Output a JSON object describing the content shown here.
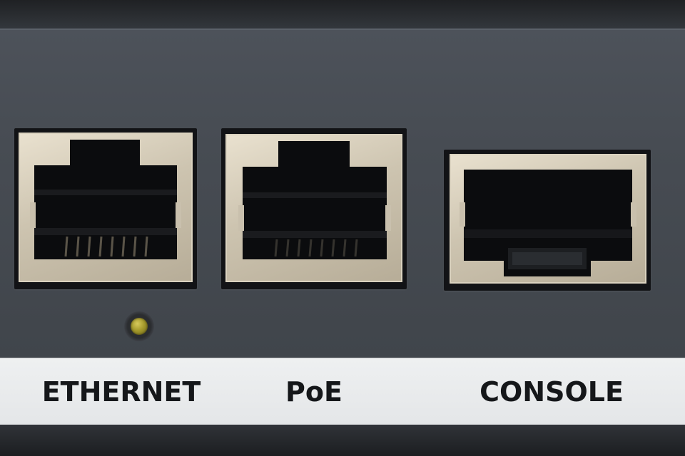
{
  "panel": {
    "ports": [
      {
        "label": "ETHERNET",
        "type": "RJ45"
      },
      {
        "label": "PoE",
        "type": "RJ45"
      },
      {
        "label": "CONSOLE",
        "type": "RJ45"
      }
    ],
    "status_led": {
      "icon": "status-led-icon",
      "color": "#b6aa33"
    }
  },
  "colors": {
    "panel": "#474c53",
    "label_strip": "#eceeef",
    "label_text": "#15171a",
    "port_frame": "#d3cab6"
  }
}
